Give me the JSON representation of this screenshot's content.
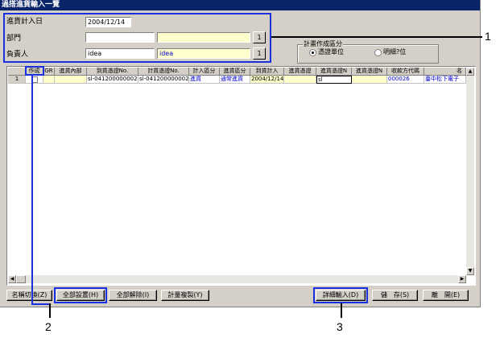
{
  "window": {
    "title": "過搭進貨輸入一覽"
  },
  "form": {
    "date_label": "進貨計入日",
    "date_value": "2004/12/14",
    "dept_label": "部門",
    "dept_code": "",
    "dept_name": "",
    "owner_label": "負責人",
    "owner_code": "idea",
    "owner_name": "idea",
    "lookup_label": "1"
  },
  "plan_group": {
    "title": "計畫作成區分",
    "options": [
      {
        "label": "憑證單位",
        "selected": true
      },
      {
        "label": "明細?位",
        "selected": false
      }
    ]
  },
  "grid": {
    "columns": [
      "作成",
      "GR",
      "進貨內部",
      "到貨憑證No.",
      "計貨憑證No.",
      "計入區分",
      "進貨區分",
      "到貨計入",
      "進貨憑證",
      "進貨憑證N",
      "進貨憑證N",
      "收款方代碼",
      "名"
    ],
    "rows": [
      {
        "index": "1",
        "cells": [
          "",
          "",
          "",
          "sl-041200000002",
          "sl-041200000002",
          "進貨",
          "通常進貨",
          "2004/12/14",
          "",
          "sl",
          "",
          "000026",
          "臺中松下電子"
        ]
      }
    ]
  },
  "buttons": {
    "name_switch": "名稱切換(Z)",
    "set_all": "全部設置(H)",
    "clear_all": "全部解除(I)",
    "copy_plan": "計量複製(Y)",
    "detail_input": "詳細輸入(D)",
    "save": "儲　存(S)",
    "exit": "離　開(E)"
  },
  "callouts": {
    "one": "1",
    "two": "2",
    "three": "3"
  },
  "colors": {
    "callout": "#1a2fe0",
    "title_bar": "#0a246a",
    "editable": "#ffffcc"
  }
}
